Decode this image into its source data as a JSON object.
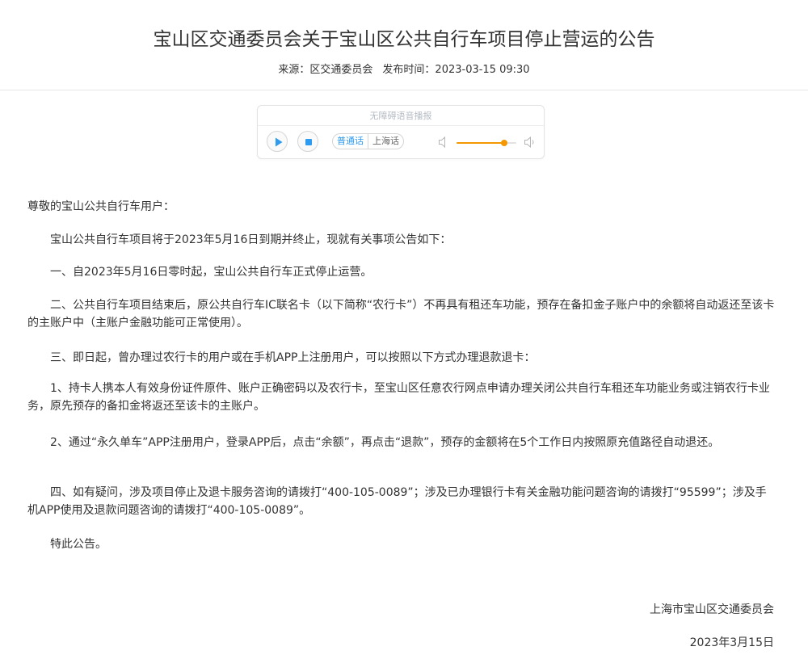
{
  "article": {
    "title": "宝山区交通委员会关于宝山区公共自行车项目停止营运的公告",
    "source": "来源：区交通委员会",
    "publish_time": "发布时间：2023-03-15 09:30"
  },
  "player": {
    "label": "无障碍语音播报",
    "dialects": [
      "普通话",
      "上海话"
    ],
    "active_dialect": "普通话",
    "volume": 0.8,
    "accent_color": "#2d9bf0",
    "volume_color": "#f39800"
  },
  "body": {
    "greeting": "尊敬的宝山公共自行车用户：",
    "paragraphs": [
      "宝山公共自行车项目将于2023年5月16日到期并终止，现就有关事项公告如下：",
      "一、自2023年5月16日零时起，宝山公共自行车正式停止运营。",
      "二、公共自行车项目结束后，原公共自行车IC联名卡（以下简称“农行卡”）不再具有租还车功能，预存在备扣金子账户中的余额将自动返还至该卡的主账户中（主账户金融功能可正常使用）。",
      "三、即日起，曾办理过农行卡的用户或在手机APP上注册用户，可以按照以下方式办理退款退卡：",
      "1、持卡人携本人有效身份证件原件、账户正确密码以及农行卡，至宝山区任意农行网点申请办理关闭公共自行车租还车功能业务或注销农行卡业务，原先预存的备扣金将返还至该卡的主账户。",
      "2、通过“永久单车”APP注册用户，登录APP后，点击“余额”，再点击“退款”，预存的金额将在5个工作日内按照原充值路径自动退还。",
      "四、如有疑问，涉及项目停止及退卡服务咨询的请拨打“400-105-0089”；涉及已办理银行卡有关金融功能问题咨询的请拨打“95599”；涉及手机APP使用及退款问题咨询的请拨打“400-105-0089”。",
      "特此公告。"
    ],
    "signature": "上海市宝山区交通委员会",
    "date": "2023年3月15日"
  }
}
